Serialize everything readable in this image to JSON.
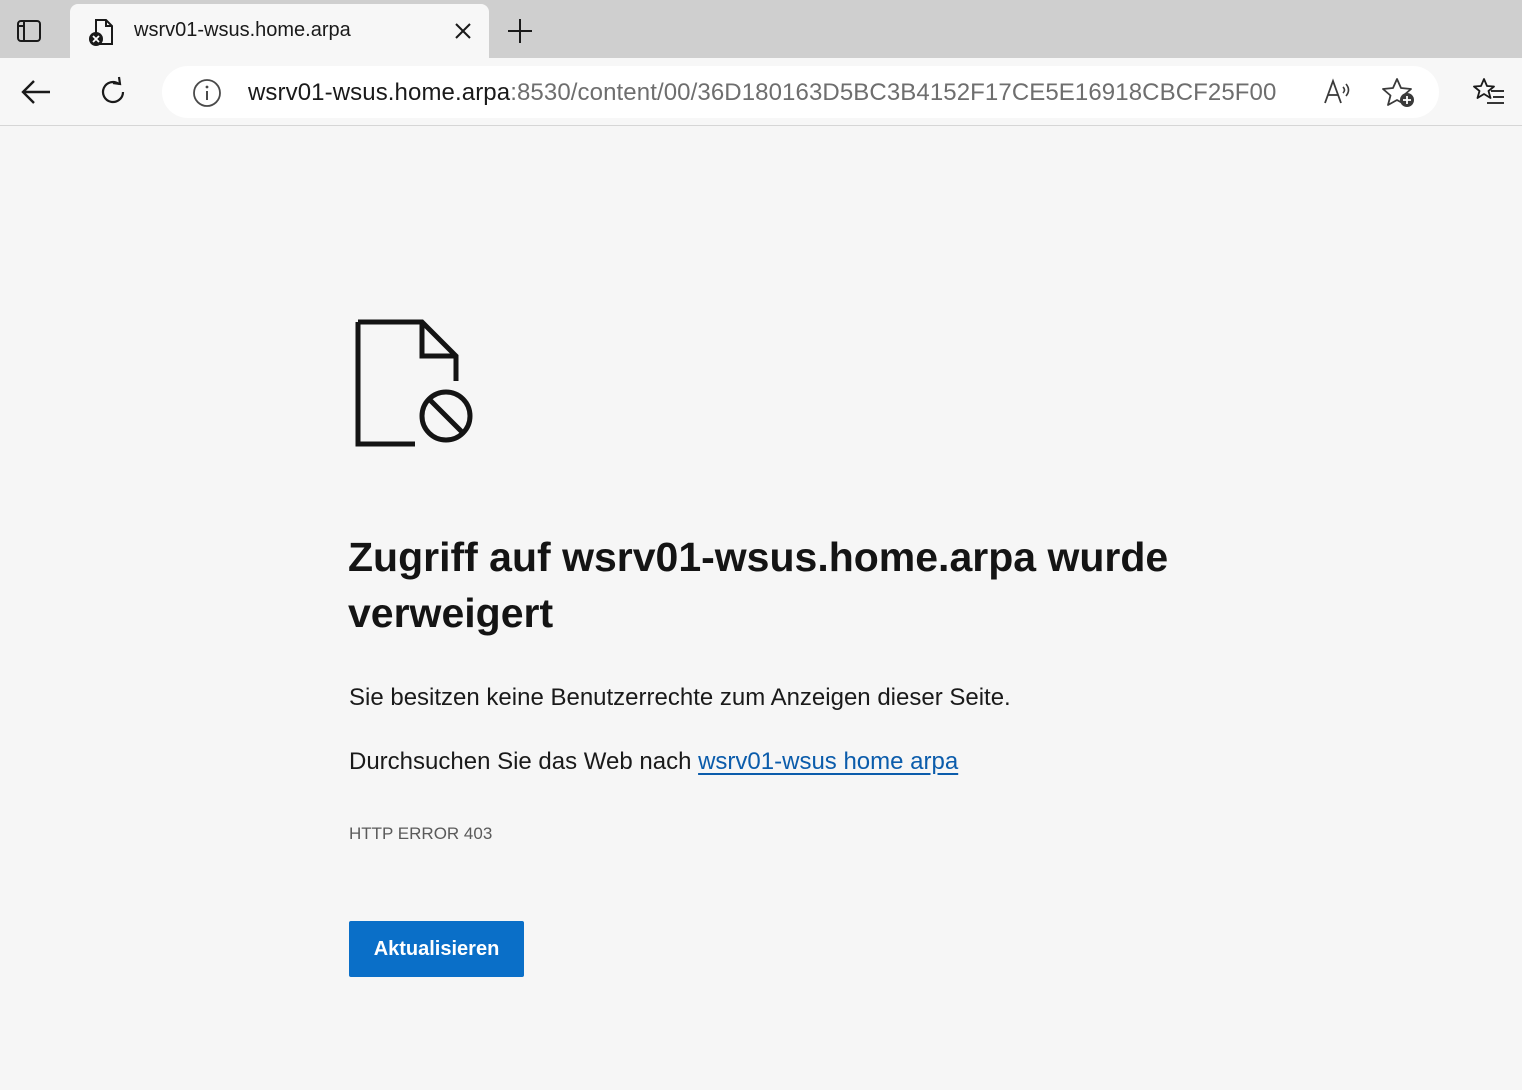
{
  "browser": {
    "tab": {
      "title": "wsrv01-wsus.home.arpa"
    },
    "address_bar": {
      "host": "wsrv01-wsus.home.arpa",
      "path": ":8530/content/00/36D180163D5BC3B4152F17CE5E16918CBCF25F00"
    },
    "icons": {
      "tab_actions": "tab-actions-icon",
      "tab_favicon": "document-error-icon",
      "tab_close": "close-icon",
      "new_tab": "plus-icon",
      "back": "back-arrow-icon",
      "refresh": "refresh-icon",
      "site_info": "info-icon",
      "read_aloud": "read-aloud-icon",
      "add_favorite": "star-add-icon",
      "favorites": "favorites-list-icon"
    }
  },
  "error_page": {
    "icon": "document-blocked-icon",
    "title": "Zugriff auf wsrv01-wsus.home.arpa wurde verweigert",
    "description": "Sie besitzen keine Benutzerrechte zum Anzeigen dieser Seite.",
    "search_prefix": "Durchsuchen Sie das Web nach ",
    "search_link": "wsrv01-wsus home arpa",
    "error_code": "HTTP ERROR 403",
    "reload_button": "Aktualisieren"
  },
  "colors": {
    "page_background": "#f6f6f6",
    "tabstrip_background": "#cfcfcf",
    "link": "#0b5cab",
    "primary_button": "#0a6fc8"
  }
}
